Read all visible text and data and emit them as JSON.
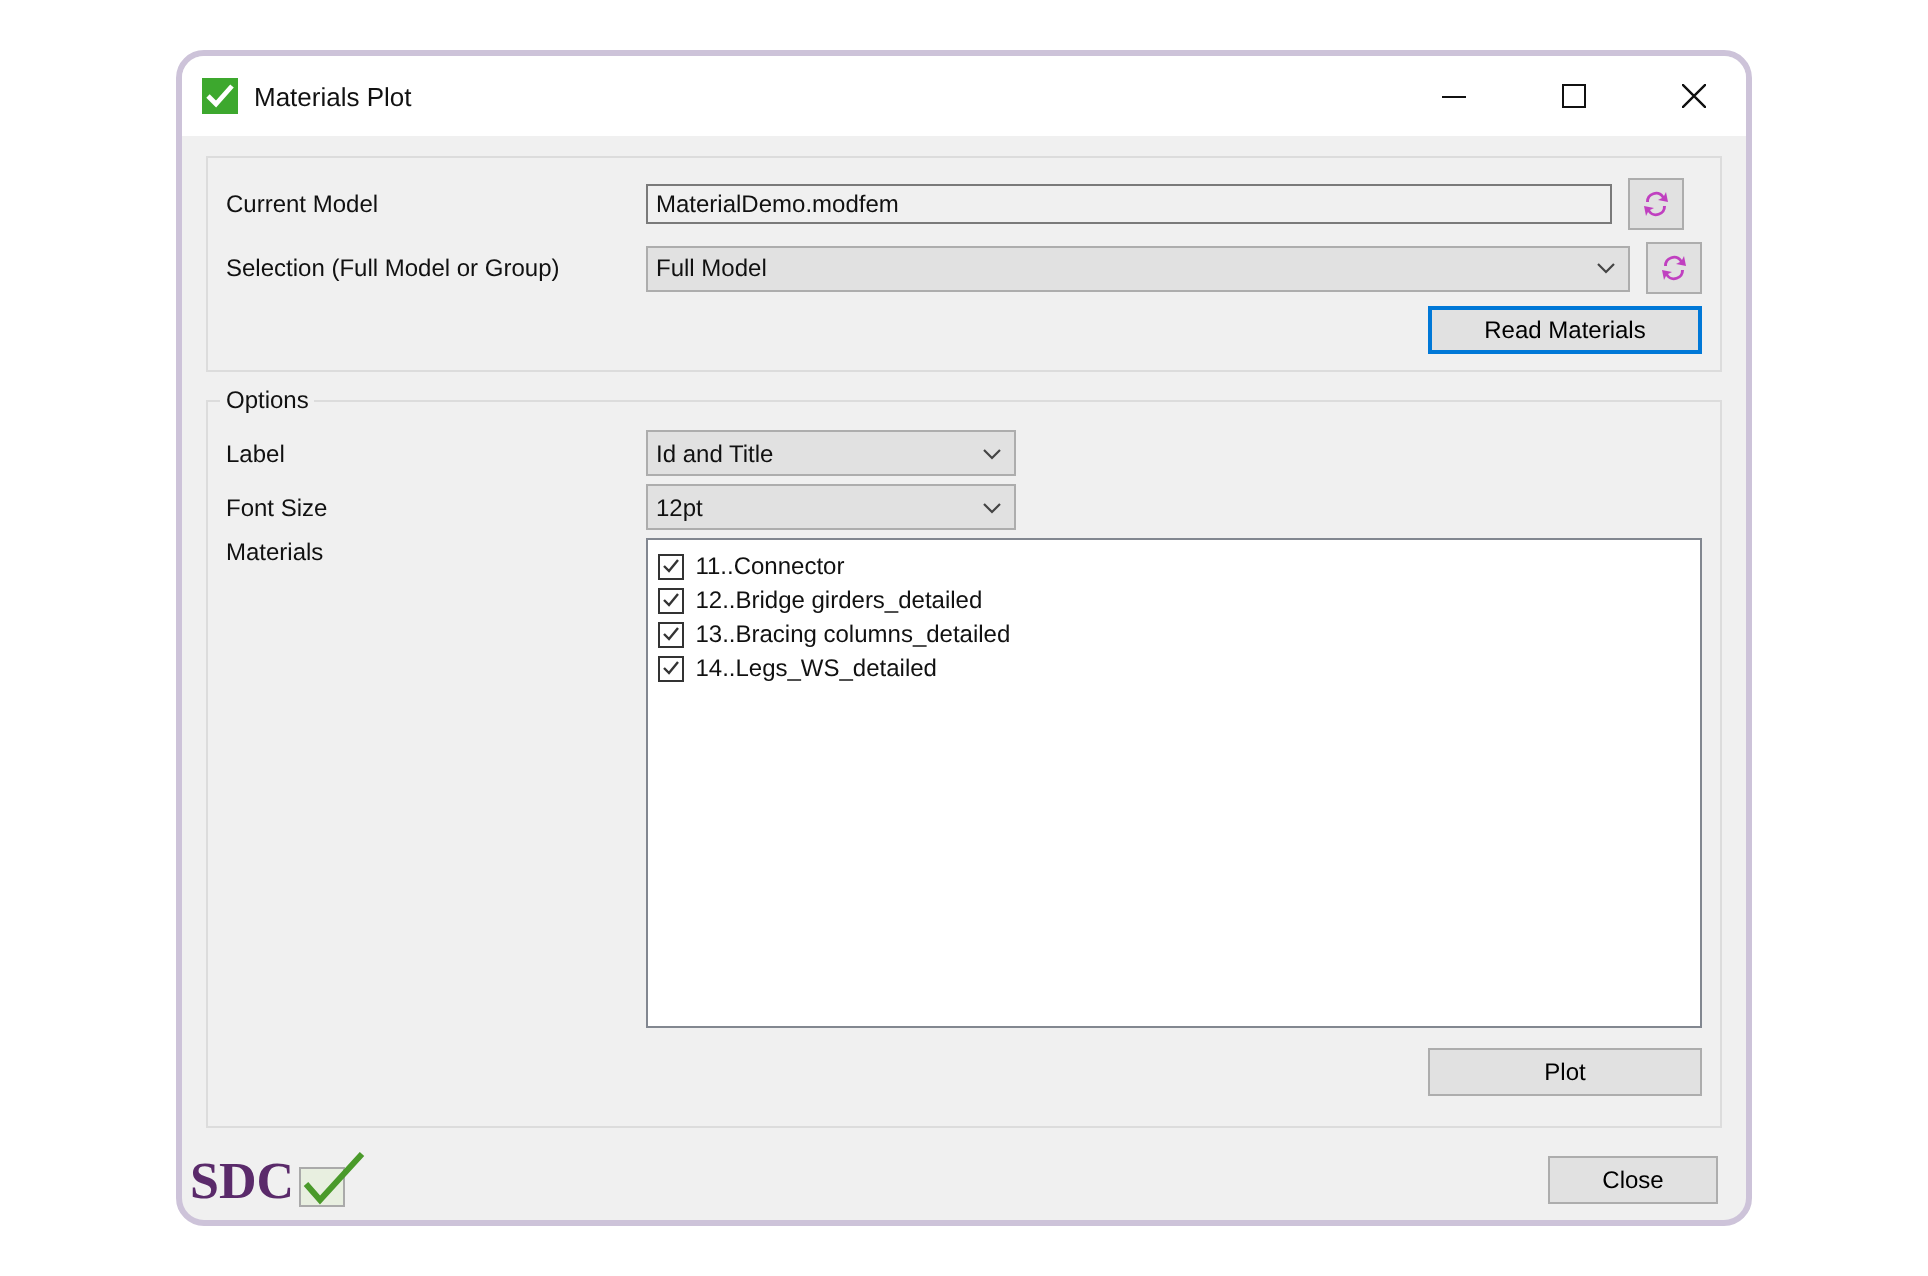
{
  "window": {
    "title": "Materials Plot"
  },
  "model": {
    "current_model_label": "Current Model",
    "current_model_value": "MaterialDemo.modfem",
    "selection_label": "Selection (Full Model or Group)",
    "selection_value": "Full Model",
    "read_button": "Read Materials"
  },
  "options": {
    "legend": "Options",
    "label_label": "Label",
    "label_value": "Id and Title",
    "font_size_label": "Font Size",
    "font_size_value": "12pt",
    "materials_label": "Materials",
    "materials": [
      {
        "label": "11..Connector",
        "checked": true
      },
      {
        "label": "12..Bridge girders_detailed",
        "checked": true
      },
      {
        "label": "13..Bracing columns_detailed",
        "checked": true
      },
      {
        "label": "14..Legs_WS_detailed",
        "checked": true
      }
    ],
    "plot_button": "Plot"
  },
  "footer": {
    "logo": "SDC",
    "close_button": "Close"
  }
}
